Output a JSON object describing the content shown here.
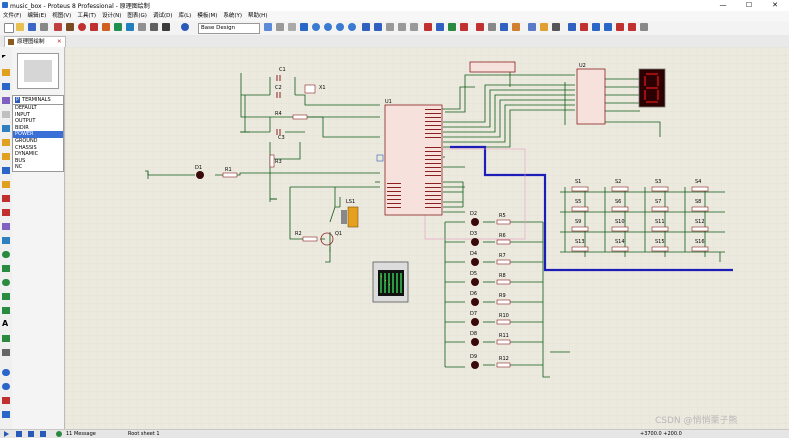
{
  "window": {
    "title": "music_box - Proteus 8 Professional - 原理图绘制",
    "minimize": "—",
    "maximize": "☐",
    "close": "✕"
  },
  "menu": [
    "文件(F)",
    "编辑(E)",
    "视图(V)",
    "工具(T)",
    "设计(N)",
    "图表(G)",
    "调试(D)",
    "库(L)",
    "模板(M)",
    "系统(Y)",
    "帮助(H)"
  ],
  "toolbar": {
    "style_select": "Base Design"
  },
  "tab": {
    "label": "原理图绘制",
    "close": "✕"
  },
  "panel": {
    "header": "TERMINALS",
    "pick": "P",
    "items": [
      "DEFAULT",
      "INPUT",
      "OUTPUT",
      "BIDIR",
      "POWER",
      "GROUND",
      "CHASSIS",
      "DYNAMIC",
      "BUS",
      "NC"
    ],
    "selected": "POWER"
  },
  "status": {
    "messages": "11 Message",
    "selection": "Root sheet 1",
    "coords": "+3700.0   +200.0"
  },
  "schematic": {
    "u1": "U1",
    "u2": "U2",
    "ls1": "LS1",
    "q1": "Q1",
    "x1": "X1",
    "d1": "D1",
    "caps": [
      "C1",
      "C2",
      "C3"
    ],
    "resistors_top": [
      "R4",
      "R1",
      "R3",
      "R2"
    ],
    "leds": [
      "D2",
      "D3",
      "D4",
      "D5",
      "D6",
      "D7",
      "D8",
      "D9"
    ],
    "led_r": [
      "R5",
      "R6",
      "R7",
      "R8",
      "R9",
      "R10",
      "R11",
      "R12"
    ],
    "switches": [
      "S1",
      "S2",
      "S3",
      "S4",
      "S5",
      "S6",
      "S7",
      "S8",
      "S9",
      "S10",
      "S11",
      "S12",
      "S13",
      "S14",
      "S15",
      "S16"
    ]
  },
  "watermark": "CSDN @悄悄栗子熊"
}
